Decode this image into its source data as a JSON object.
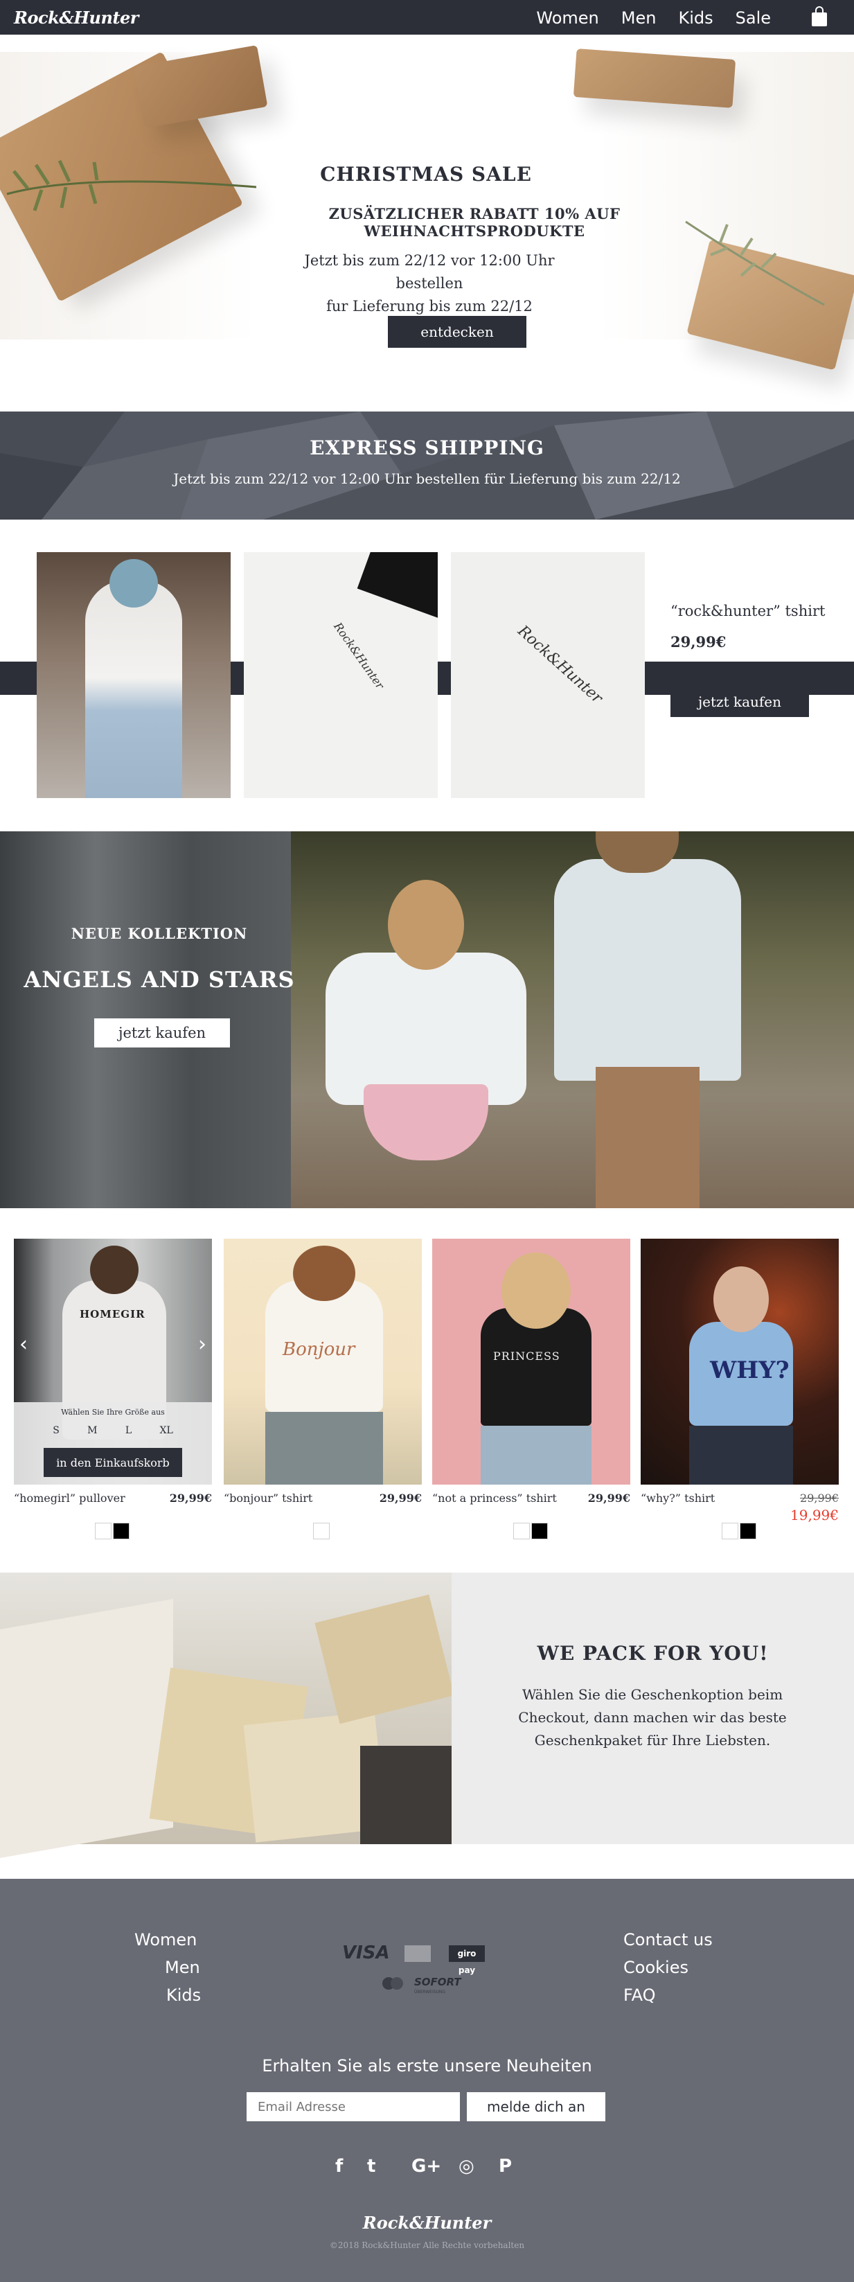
{
  "header": {
    "logo": "Rock&Hunter",
    "nav": [
      "Women",
      "Men",
      "Kids",
      "Sale"
    ],
    "cart_icon": "shopping-bag-icon"
  },
  "xmas": {
    "title": "CHRISTMAS SALE",
    "subtitle": "ZUSÄTZLICHER RABATT 10% AUF WEIHNACHTSPRODUKTE",
    "line1": "Jetzt bis zum 22/12 vor 12:00 Uhr bestellen",
    "line2": "fur Lieferung bis zum 22/12",
    "button": "entdecken"
  },
  "express": {
    "title": "EXPRESS SHIPPING",
    "subtitle": "Jetzt bis zum 22/12 vor 12:00 Uhr bestellen für Lieferung bis zum 22/12"
  },
  "featured": {
    "name": "“rock&hunter” tshirt",
    "price": "29,99€",
    "button": "jetzt kaufen",
    "print": "Rock&Hunter"
  },
  "hero": {
    "kicker": "NEUE KOLLEKTION",
    "title": "ANGELS AND STARS",
    "button": "jetzt kaufen"
  },
  "products": [
    {
      "name": "“homegirl” pullover",
      "price": "29,99€",
      "print": "HOMEGIR",
      "swatches": [
        "#ffffff",
        "#000000"
      ]
    },
    {
      "name": "“bonjour” tshirt",
      "price": "29,99€",
      "print": "Bonjour",
      "swatches": [
        "#ffffff"
      ]
    },
    {
      "name": "“not a princess” tshirt",
      "price": "29,99€",
      "print": "PRINCESS",
      "swatches": [
        "#ffffff",
        "#000000"
      ]
    },
    {
      "name": "“why?” tshirt",
      "old_price": "29,99€",
      "price": "19,99€",
      "print": "WHY?",
      "swatches": [
        "#ffffff",
        "#000000"
      ]
    }
  ],
  "quickbuy": {
    "size_label": "Wählen Sie Ihre Größe aus",
    "sizes": [
      "S",
      "M",
      "L",
      "XL"
    ],
    "button": "in den Einkaufskorb"
  },
  "pack": {
    "title": "WE PACK FOR YOU!",
    "body": "Wählen Sie die Geschenkoption beim Checkout, dann machen wir das beste Geschenkpaket für Ihre Liebsten."
  },
  "footer": {
    "left_links": [
      "Women",
      "Men",
      "Kids"
    ],
    "right_links": [
      "Contact us",
      "Cookies",
      "FAQ"
    ],
    "payments": [
      "VISA",
      "giro pay",
      "SOFORT"
    ],
    "payment_caption": "ÜBERWEISUNG",
    "newsletter": "Erhalten Sie als erste unsere Neuheiten",
    "email_placeholder": "Email Adresse",
    "subscribe": "melde dich an",
    "social_icons": [
      "facebook-icon",
      "twitter-icon",
      "google-plus-icon",
      "instagram-icon",
      "pinterest-icon"
    ],
    "social_glyphs": [
      "f",
      "t",
      "G+",
      "◎",
      "P"
    ],
    "logo": "Rock&Hunter",
    "copyright": "©2018 Rock&Hunter Alle Rechte vorbehalten"
  }
}
